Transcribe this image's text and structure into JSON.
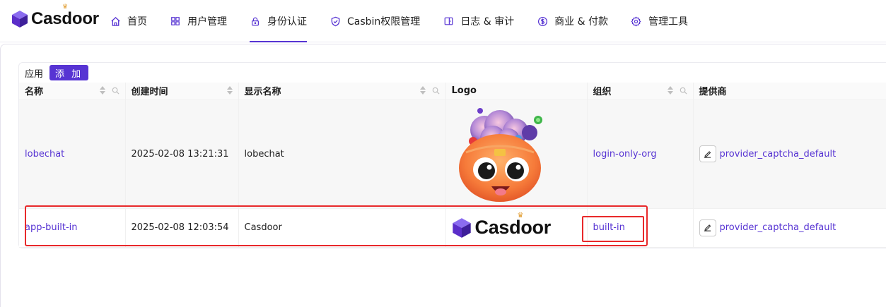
{
  "brand": {
    "name": "Casdoor"
  },
  "nav": {
    "items": [
      {
        "label": "首页",
        "icon": "home-icon"
      },
      {
        "label": "用户管理",
        "icon": "grid-icon"
      },
      {
        "label": "身份认证",
        "icon": "lock-icon",
        "active": true
      },
      {
        "label": "Casbin权限管理",
        "icon": "shield-check-icon"
      },
      {
        "label": "日志 & 审计",
        "icon": "log-icon"
      },
      {
        "label": "商业 & 付款",
        "icon": "dollar-icon"
      },
      {
        "label": "管理工具",
        "icon": "gear-icon"
      }
    ]
  },
  "page": {
    "title": "应用",
    "add_label": "添 加"
  },
  "table": {
    "columns": [
      "名称",
      "创建时间",
      "显示名称",
      "Logo",
      "组织",
      "提供商"
    ],
    "rows": [
      {
        "name": "lobechat",
        "created": "2025-02-08 13:21:31",
        "display_name": "lobechat",
        "logo": "lobehub-emoji-logo",
        "organization": "login-only-org",
        "provider": "provider_captcha_default"
      },
      {
        "name": "app-built-in",
        "created": "2025-02-08 12:03:54",
        "display_name": "Casdoor",
        "logo": "casdoor-wordmark-logo",
        "logo_text": "Casdoor",
        "organization": "built-in",
        "provider": "provider_captcha_default"
      }
    ]
  },
  "colors": {
    "accent": "#5734d3",
    "highlight": "#e8292b"
  }
}
